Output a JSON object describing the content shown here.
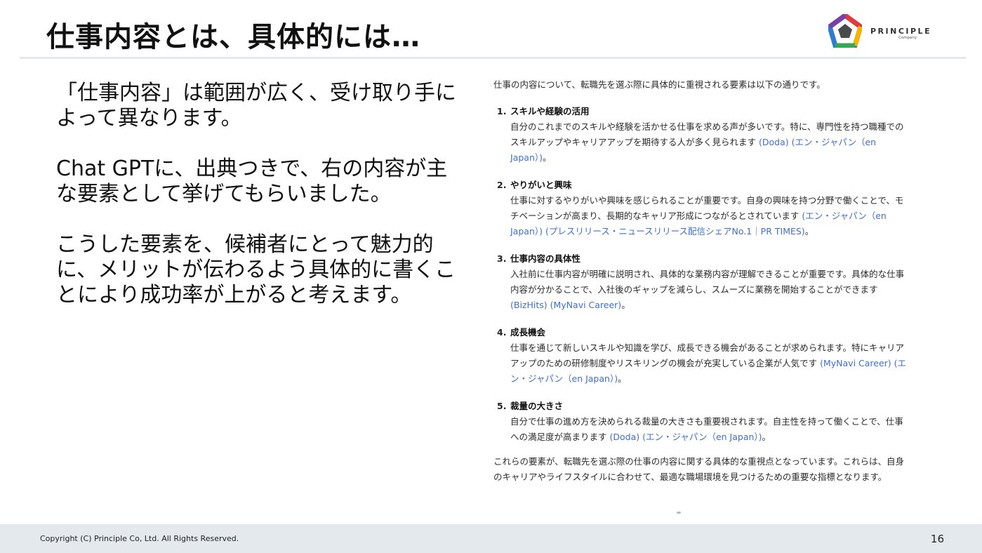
{
  "slide": {
    "title": "仕事内容とは、具体的には…",
    "logo_word": "PRINCIPLE",
    "logo_sub": "Company",
    "left_paragraphs": [
      "「仕事内容」は範囲が広く、受け取り手によって異なります。",
      "Chat GPTに、出典つきで、右の内容が主な要素として挙げてもらいました。",
      "こうした要素を、候補者にとって魅力的に、メリットが伝わるよう具体的に書くことにより成功率が上がると考えます。"
    ]
  },
  "quote": {
    "intro": "仕事の内容について、転職先を選ぶ際に具体的に重視される要素は以下の通りです。",
    "items": [
      {
        "number": "1.",
        "heading": "スキルや経験の活用",
        "text": "自分のこれまでのスキルや経験を活かせる仕事を求める声が多いです。特に、専門性を持つ職種でのスキルアップやキャリアアップを期待する人が多く見られます",
        "sources": " (Doda) (エン・ジャパン（en Japan）)",
        "tail": "。"
      },
      {
        "number": "2.",
        "heading": "やりがいと興味",
        "text": "仕事に対するやりがいや興味を感じられることが重要です。自身の興味を持つ分野で働くことで、モチベーションが高まり、長期的なキャリア形成につながるとされています",
        "sources": " (エン・ジャパン（en Japan）) (プレスリリース・ニュースリリース配信シェアNo.1｜PR TIMES)",
        "tail": "。"
      },
      {
        "number": "3.",
        "heading": "仕事内容の具体性",
        "text": "入社前に仕事内容が明確に説明され、具体的な業務内容が理解できることが重要です。具体的な仕事内容が分かることで、入社後のギャップを減らし、スムーズに業務を開始することができます",
        "sources": " (BizHits) (MyNavi Career)",
        "tail": "。"
      },
      {
        "number": "4.",
        "heading": "成長機会",
        "text": "仕事を通じて新しいスキルや知識を学び、成長できる機会があることが求められます。特にキャリアアップのための研修制度やリスキリングの機会が充実している企業が人気です",
        "sources": " (MyNavi Career) (エン・ジャパン（en Japan）)",
        "tail": "。"
      },
      {
        "number": "5.",
        "heading": "裁量の大きさ",
        "text": "自分で仕事の進め方を決められる裁量の大きさも重要視されます。自主性を持って働くことで、仕事への満足度が高まります",
        "sources": " (Doda) (エン・ジャパン（en Japan）)",
        "tail": "。"
      }
    ],
    "closing": "これらの要素が、転職先を選ぶ際の仕事の内容に関する具体的な重視点となっています。これらは、自身のキャリアやライフスタイルに合わせて、最適な職場環境を見つけるための重要な指標となります。"
  },
  "footer": {
    "copyright": "Copyright (C) Principle Co, Ltd. All Rights Reserved.",
    "page_number": "16"
  }
}
